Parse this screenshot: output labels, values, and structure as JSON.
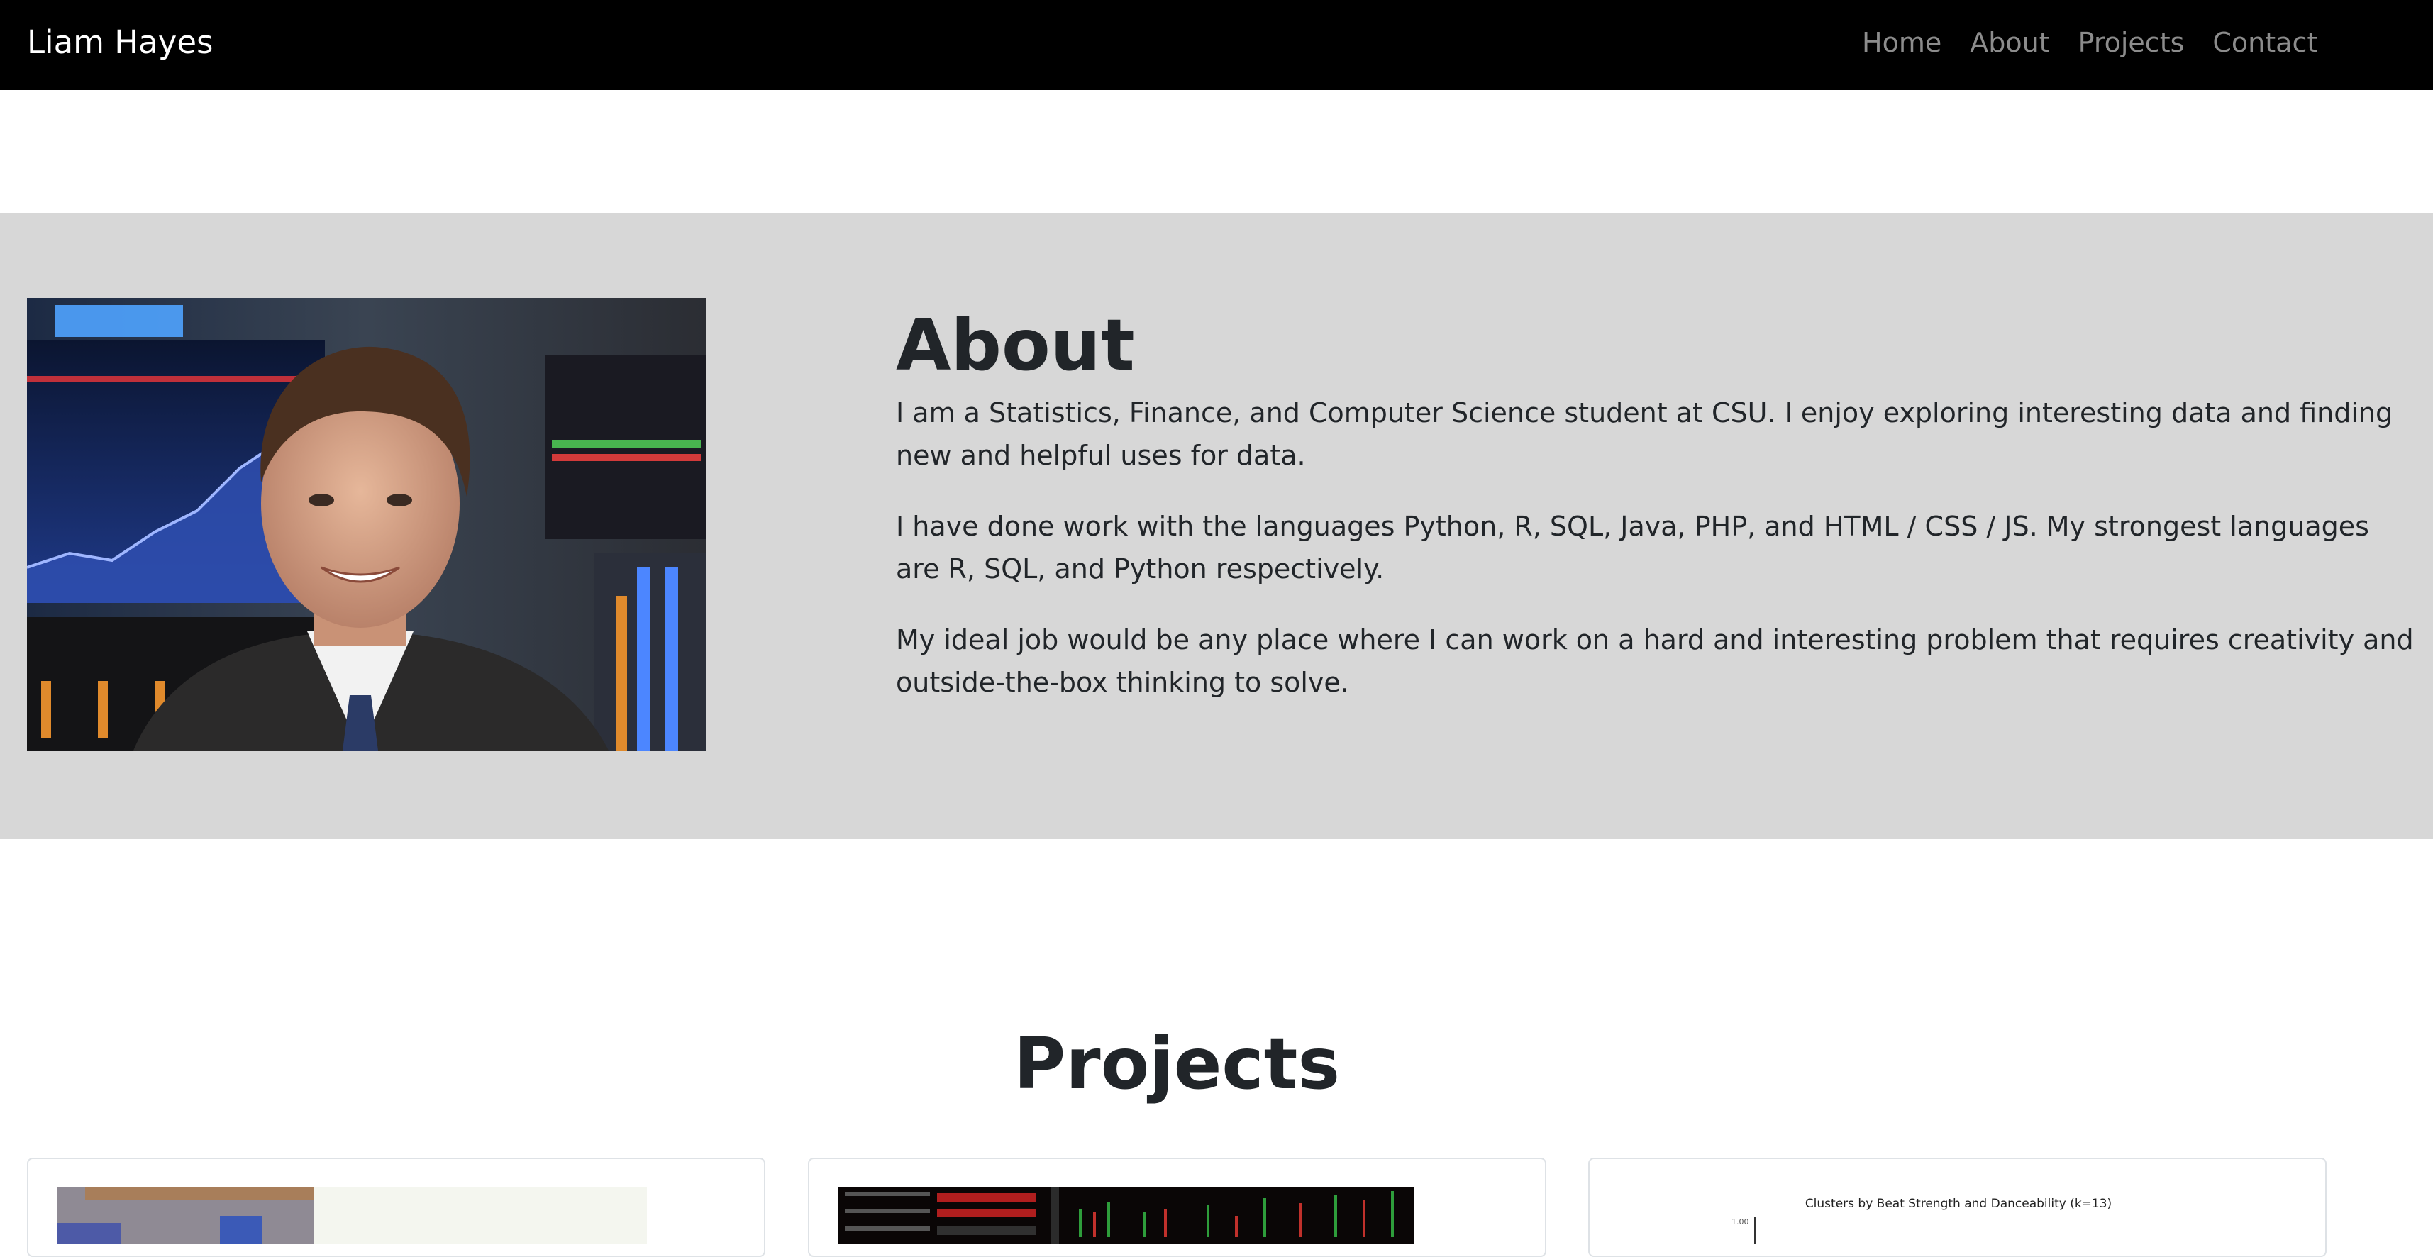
{
  "navbar": {
    "brand": "Liam Hayes",
    "links": [
      "Home",
      "About",
      "Projects",
      "Contact"
    ]
  },
  "about": {
    "title": "About",
    "paragraphs": [
      "I am a Statistics, Finance, and Computer Science student at CSU. I enjoy exploring interesting data and finding new and helpful uses for data.",
      "I have done work with the languages Python, R, SQL, Java, PHP, and HTML / CSS / JS. My strongest languages are R, SQL, and Python respectively.",
      "My ideal job would be any place where I can work on a hard and interesting problem that requires creativity and outside-the-box thinking to solve."
    ]
  },
  "projects": {
    "title": "Projects",
    "cards": [
      {
        "thumbnail": "project-photo"
      },
      {
        "thumbnail": "trading-terminal-screenshot"
      },
      {
        "thumbnail": "cluster-chart",
        "chart_title": "Clusters by Beat Strength and Danceability (k=13)",
        "ytick": "1.00"
      }
    ]
  },
  "colors": {
    "navbar_bg": "#000000",
    "about_bg": "#d7d7d7",
    "link_muted": "rgba(255,255,255,0.55)",
    "text": "#212529"
  }
}
